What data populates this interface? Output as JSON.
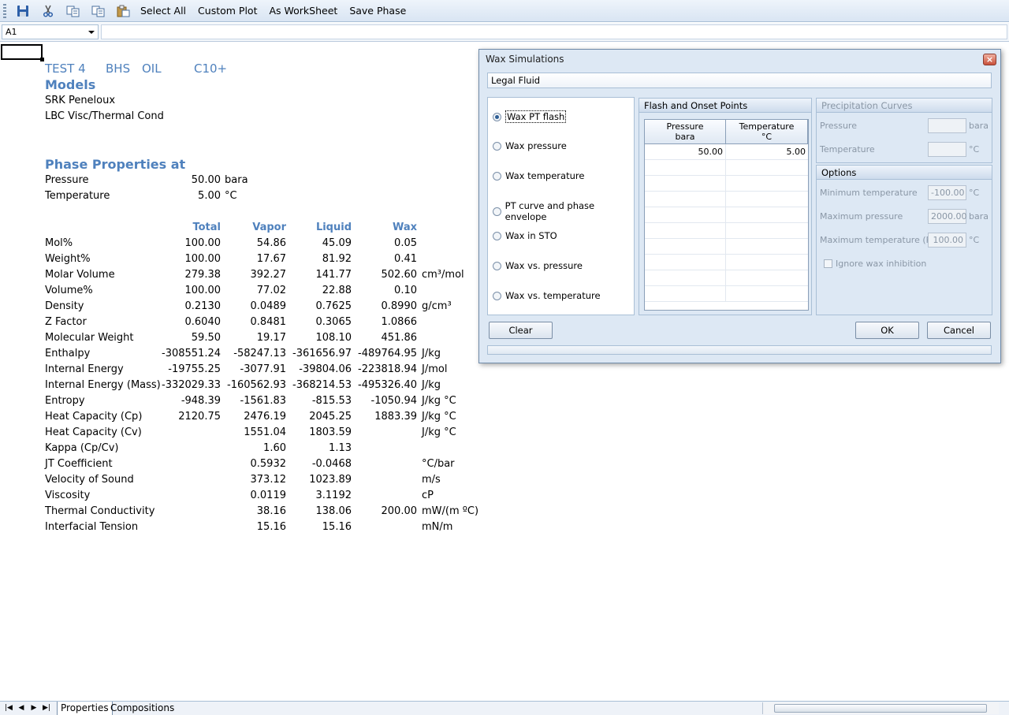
{
  "toolbar": {
    "buttons": [
      "Select All",
      "Custom Plot",
      "As WorkSheet",
      "Save Phase"
    ],
    "icons": [
      "save-icon",
      "cut-icon",
      "copy-icon",
      "copy-alt-icon",
      "paste-icon"
    ]
  },
  "formula_bar": {
    "cell_ref": "A1",
    "formula": ""
  },
  "sheet": {
    "title_parts": [
      "TEST 4",
      "BHS",
      "OIL",
      "C10+"
    ],
    "models_heading": "Models",
    "models": [
      "SRK Peneloux",
      "LBC Visc/Thermal Cond"
    ],
    "phase_heading": "Phase Properties at",
    "conditions": [
      {
        "label": "Pressure",
        "value": "50.00",
        "unit": "bara"
      },
      {
        "label": "Temperature",
        "value": "5.00",
        "unit": "°C"
      }
    ],
    "columns": [
      "Total",
      "Vapor",
      "Liquid",
      "Wax"
    ],
    "rows": [
      {
        "label": "Mol%",
        "total": "100.00",
        "vapor": "54.86",
        "liquid": "45.09",
        "wax": "0.05",
        "unit": ""
      },
      {
        "label": "Weight%",
        "total": "100.00",
        "vapor": "17.67",
        "liquid": "81.92",
        "wax": "0.41",
        "unit": ""
      },
      {
        "label": "Molar Volume",
        "total": "279.38",
        "vapor": "392.27",
        "liquid": "141.77",
        "wax": "502.60",
        "unit": "cm³/mol"
      },
      {
        "label": "Volume%",
        "total": "100.00",
        "vapor": "77.02",
        "liquid": "22.88",
        "wax": "0.10",
        "unit": ""
      },
      {
        "label": "Density",
        "total": "0.2130",
        "vapor": "0.0489",
        "liquid": "0.7625",
        "wax": "0.8990",
        "unit": "g/cm³"
      },
      {
        "label": "Z Factor",
        "total": "0.6040",
        "vapor": "0.8481",
        "liquid": "0.3065",
        "wax": "1.0866",
        "unit": ""
      },
      {
        "label": "Molecular Weight",
        "total": "59.50",
        "vapor": "19.17",
        "liquid": "108.10",
        "wax": "451.86",
        "unit": ""
      },
      {
        "label": "Enthalpy",
        "total": "-308551.24",
        "vapor": "-58247.13",
        "liquid": "-361656.97",
        "wax": "-489764.95",
        "unit": "J/kg"
      },
      {
        "label": "Internal Energy",
        "total": "-19755.25",
        "vapor": "-3077.91",
        "liquid": "-39804.06",
        "wax": "-223818.94",
        "unit": "J/mol"
      },
      {
        "label": "Internal Energy (Mass)",
        "total": "-332029.33",
        "vapor": "-160562.93",
        "liquid": "-368214.53",
        "wax": "-495326.40",
        "unit": "J/kg"
      },
      {
        "label": "Entropy",
        "total": "-948.39",
        "vapor": "-1561.83",
        "liquid": "-815.53",
        "wax": "-1050.94",
        "unit": "J/kg °C"
      },
      {
        "label": "Heat Capacity (Cp)",
        "total": "2120.75",
        "vapor": "2476.19",
        "liquid": "2045.25",
        "wax": "1883.39",
        "unit": "J/kg °C"
      },
      {
        "label": "Heat Capacity (Cv)",
        "total": "",
        "vapor": "1551.04",
        "liquid": "1803.59",
        "wax": "",
        "unit": "J/kg °C"
      },
      {
        "label": "Kappa (Cp/Cv)",
        "total": "",
        "vapor": "1.60",
        "liquid": "1.13",
        "wax": "",
        "unit": ""
      },
      {
        "label": "JT Coefficient",
        "total": "",
        "vapor": "0.5932",
        "liquid": "-0.0468",
        "wax": "",
        "unit": "°C/bar"
      },
      {
        "label": "Velocity of Sound",
        "total": "",
        "vapor": "373.12",
        "liquid": "1023.89",
        "wax": "",
        "unit": "m/s"
      },
      {
        "label": "Viscosity",
        "total": "",
        "vapor": "0.0119",
        "liquid": "3.1192",
        "wax": "",
        "unit": "cP"
      },
      {
        "label": "Thermal Conductivity",
        "total": "",
        "vapor": "38.16",
        "liquid": "138.06",
        "wax": "200.00",
        "unit": "mW/(m ºC)"
      },
      {
        "label": "Interfacial Tension",
        "total": "",
        "vapor": "15.16",
        "liquid": "15.16",
        "wax": "",
        "unit": "mN/m"
      }
    ]
  },
  "sheet_tabs": [
    "Properties",
    "Compositions"
  ],
  "dialog": {
    "title": "Wax Simulations",
    "fluid": "Legal Fluid",
    "options": [
      "Wax PT flash",
      "Wax pressure",
      "Wax temperature",
      "PT curve and phase envelope",
      "Wax in STO",
      "Wax vs. pressure",
      "Wax vs. temperature"
    ],
    "selected_option": "Wax PT flash",
    "flash_group": {
      "title": "Flash and Onset Points",
      "col1": "Pressure",
      "col1_unit": "bara",
      "col2": "Temperature",
      "col2_unit": "°C",
      "rows": [
        {
          "p": "50.00",
          "t": "5.00"
        }
      ]
    },
    "precip_group": {
      "title": "Precipitation Curves",
      "pressure_label": "Pressure",
      "pressure_unit": "bara",
      "pressure_value": "",
      "temperature_label": "Temperature",
      "temperature_unit": "°C",
      "temperature_value": ""
    },
    "options_group": {
      "title": "Options",
      "min_temp_label": "Minimum temperature",
      "min_temp_value": "-100.00",
      "min_temp_unit": "°C",
      "max_pressure_label": "Maximum pressure",
      "max_pressure_value": "2000.00",
      "max_pressure_unit": "bara",
      "max_temp_label": "Maximum temperature (PE)",
      "max_temp_value": "100.00",
      "max_temp_unit": "°C",
      "ignore_label": "Ignore wax inhibition"
    },
    "buttons": {
      "clear": "Clear",
      "ok": "OK",
      "cancel": "Cancel"
    },
    "progress": 0
  }
}
